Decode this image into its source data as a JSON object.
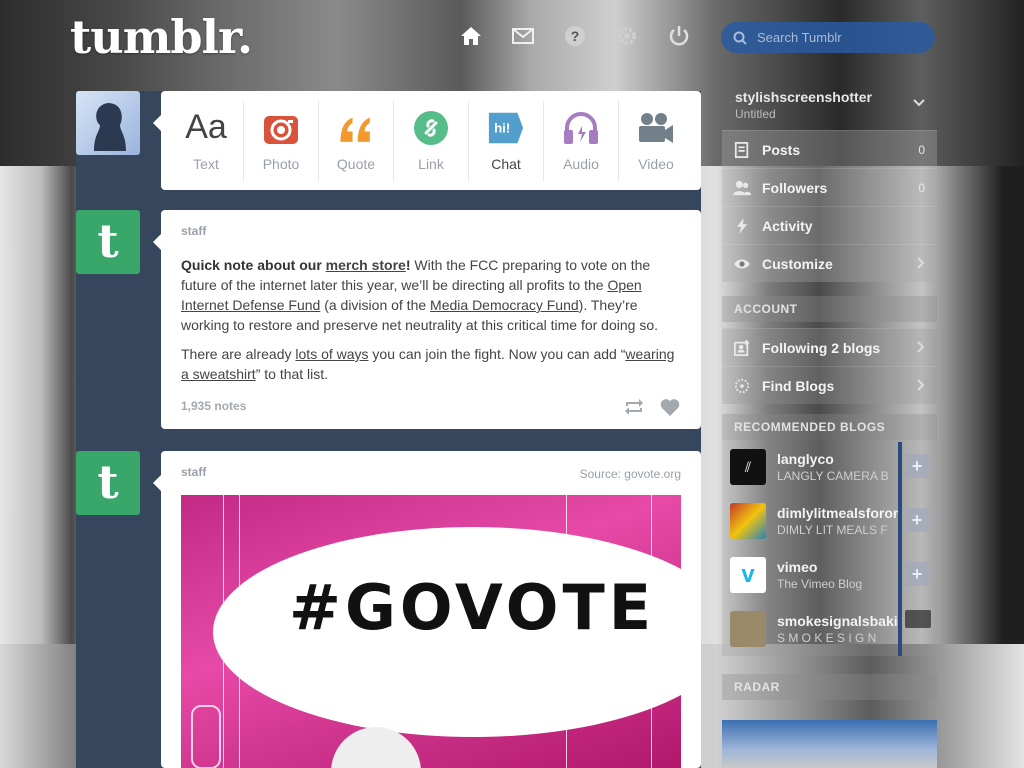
{
  "header": {
    "logo": "tumblr.",
    "search_placeholder": "Search Tumblr",
    "nav": [
      "home-icon",
      "mail-icon",
      "help-icon",
      "gear-icon",
      "power-icon"
    ]
  },
  "post_bar": [
    {
      "label": "Text",
      "icon": "text-icon",
      "color": "#444444"
    },
    {
      "label": "Photo",
      "icon": "camera-icon",
      "color": "#d9523a"
    },
    {
      "label": "Quote",
      "icon": "quote-icon",
      "color": "#f2992e"
    },
    {
      "label": "Link",
      "icon": "link-icon",
      "color": "#56bc8a"
    },
    {
      "label": "Chat",
      "icon": "chat-icon",
      "color": "#529ecc"
    },
    {
      "label": "Audio",
      "icon": "headphones-icon",
      "color": "#a77dc2"
    },
    {
      "label": "Video",
      "icon": "video-camera-icon",
      "color": "#748089"
    }
  ],
  "posts": [
    {
      "blog": "staff",
      "p1_bold": "Quick note about our ",
      "p1_link1": "merch store",
      "p1_bang": "!",
      "p1_a": " With the FCC preparing to vote on the future of the internet later this year, we’ll be directing all profits to the ",
      "p1_link2": "Open Internet Defense Fund",
      "p1_b": " (a division of the ",
      "p1_link3": "Media Democracy Fund",
      "p1_c": "). They’re working to restore and preserve net neutrality at this critical time for doing so.",
      "p2_a": "There are already ",
      "p2_link1": "lots of ways",
      "p2_b": " you can join the fight. Now you can add “",
      "p2_link2": "wearing a sweatshirt",
      "p2_c": "” to that list.",
      "notes": "1,935 notes"
    },
    {
      "blog": "staff",
      "source": "Source: govote.org",
      "image_text": "#GOVOTE"
    }
  ],
  "sidebar": {
    "blog_name": "stylishscreenshotter",
    "blog_sub": "Untitled",
    "menu": [
      {
        "label": "Posts",
        "count": "0",
        "icon": "posts-icon"
      },
      {
        "label": "Followers",
        "count": "0",
        "icon": "followers-icon"
      },
      {
        "label": "Activity",
        "count": "",
        "icon": "lightning-icon"
      },
      {
        "label": "Customize",
        "count": "",
        "icon": "eye-icon"
      }
    ],
    "account_header": "ACCOUNT",
    "account": [
      {
        "label": "Following 2 blogs",
        "icon": "following-icon"
      },
      {
        "label": "Find Blogs",
        "icon": "compass-icon"
      }
    ],
    "recommended_header": "RECOMMENDED BLOGS",
    "recommended": [
      {
        "name": "langlyco",
        "sub": "LANGLY CAMERA B",
        "avatar_color": "#111111"
      },
      {
        "name": "dimlylitmealsforone",
        "sub": "DIMLY LIT MEALS F",
        "avatar_color": "#c0392b"
      },
      {
        "name": "vimeo",
        "sub": "The Vimeo Blog",
        "avatar_color": "#ffffff"
      },
      {
        "name": "smokesignalsbaking",
        "sub": "S M O K E  S I G N",
        "avatar_color": "#9a8a6a"
      }
    ],
    "radar_header": "RADAR"
  },
  "colors": {
    "dash_blue": "#36465d",
    "staff_green": "#3aa76a",
    "search_blue": "#2a5aa0"
  }
}
